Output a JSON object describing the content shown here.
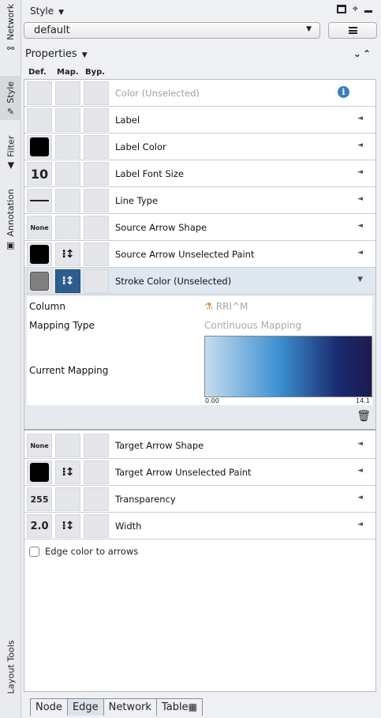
{
  "side_tabs": [
    {
      "label": "Network",
      "icon": "network-icon"
    },
    {
      "label": "Style",
      "icon": "brush-icon",
      "active": true
    },
    {
      "label": "Filter",
      "icon": "filter-icon"
    },
    {
      "label": "Annotation",
      "icon": "annotation-icon"
    },
    {
      "label": "Layout Tools",
      "icon": ""
    }
  ],
  "header": {
    "title": "Style",
    "caret": "▼"
  },
  "style_select": {
    "value": "default",
    "caret": "▼"
  },
  "properties": {
    "label": "Properties",
    "caret": "▼",
    "collapse_expand": "≚"
  },
  "columns": {
    "def": "Def.",
    "map": "Map.",
    "byp": "Byp."
  },
  "rows": [
    {
      "label": "Color (Unselected)",
      "def": "",
      "dim": true
    },
    {
      "label": "Label",
      "def": ""
    },
    {
      "label": "Label Color",
      "def": "black-swatch"
    },
    {
      "label": "Label Font Size",
      "def": "10"
    },
    {
      "label": "Line Type",
      "def": "line"
    },
    {
      "label": "Source Arrow Shape",
      "def": "None"
    },
    {
      "label": "Source Arrow Unselected Paint",
      "def": "black-swatch",
      "mapped": true
    },
    {
      "label": "Stroke Color (Unselected)",
      "def": "gray-swatch",
      "mapped": true,
      "expanded": true
    }
  ],
  "mapping": {
    "column_key": "Column",
    "column_value": "RRI^M",
    "type_key": "Mapping Type",
    "type_value": "Continuous Mapping",
    "current_key": "Current Mapping",
    "min": "0.00",
    "max": "14.1",
    "gradient_colors": [
      "#c6dcf0",
      "#3b8fd0",
      "#1a2a6e",
      "#1d1b4f"
    ]
  },
  "rows_after": [
    {
      "label": "Target Arrow Shape",
      "def": "None"
    },
    {
      "label": "Target Arrow Unselected Paint",
      "def": "black-swatch",
      "mapped": true
    },
    {
      "label": "Transparency",
      "def": "255"
    },
    {
      "label": "Width",
      "def": "2.0",
      "mapped": true
    }
  ],
  "checkbox": {
    "label": "Edge color to arrows",
    "checked": false
  },
  "bottom_tabs": [
    "Node",
    "Edge",
    "Network",
    "Table"
  ],
  "active_bottom_tab": "Edge",
  "arrow_glyph": "◄",
  "expanded_glyph": "▼",
  "info_glyph": "i",
  "map_glyph": "⁝↕",
  "trash_glyph": "🗑",
  "table_glyph": "▦"
}
